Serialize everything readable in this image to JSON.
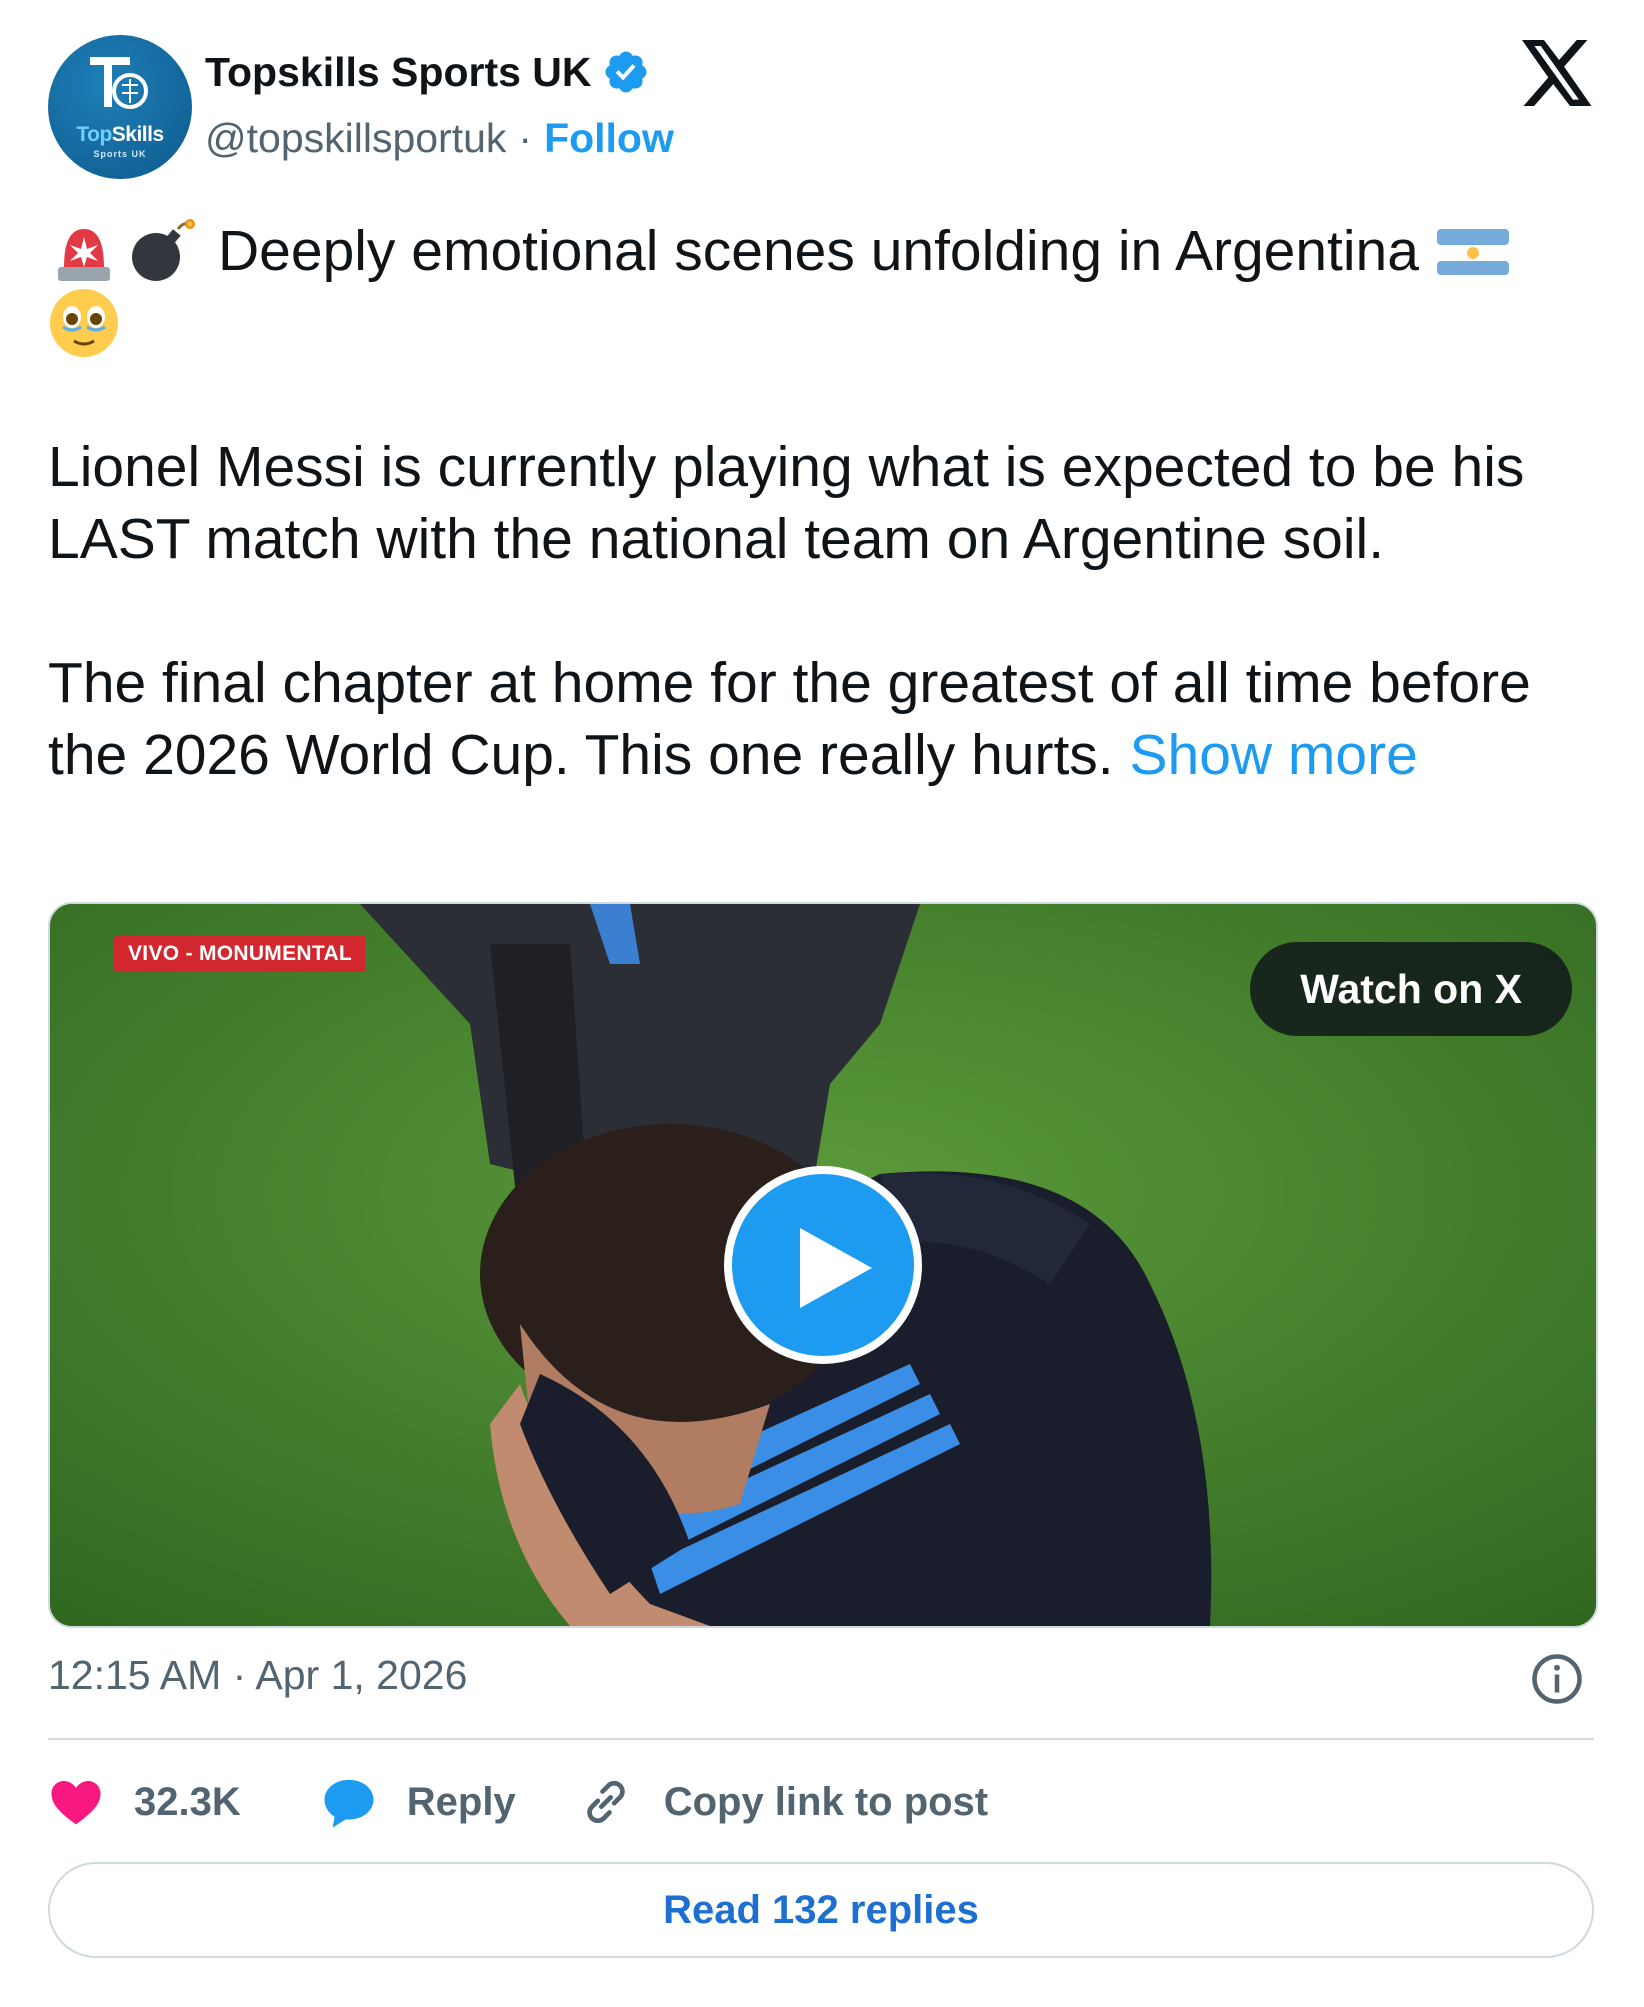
{
  "author": {
    "display_name": "Topskills Sports UK",
    "handle": "@topskillsportuk",
    "separator": "·",
    "follow_label": "Follow",
    "avatar_text_top": "Top",
    "avatar_text_rest": "Skills",
    "avatar_subtext": "Sports UK",
    "avatar_icon": "topskills-logo",
    "verified_icon": "verified-badge-icon"
  },
  "tweet": {
    "line1_text": "Deeply emotional scenes unfolding in Argentina",
    "line1_emojis": [
      "police-light-emoji",
      "bomb-emoji",
      "argentina-flag-emoji",
      "holding-back-tears-emoji"
    ],
    "paragraph2": "Lionel Messi is currently playing what is expected to be his LAST match with the national team on Argentine soil.",
    "paragraph3": "The final chapter at home for the greatest of all time before the 2026 World Cup. This one really hurts.",
    "show_more_label": "Show more"
  },
  "media": {
    "live_tag": "VIVO - MONUMENTAL",
    "watch_label": "Watch on X",
    "play_icon": "play-icon"
  },
  "meta": {
    "timestamp": "12:15 AM · Apr 1, 2026",
    "info_icon": "info-icon"
  },
  "actions": {
    "like_count": "32.3K",
    "reply_label": "Reply",
    "copy_link_label": "Copy link to post",
    "read_replies_label": "Read 132 replies"
  },
  "colors": {
    "accent": "#1d9bf0",
    "like": "#f91880",
    "muted": "#536471",
    "text": "#0f1419",
    "border": "#cfd9de"
  }
}
